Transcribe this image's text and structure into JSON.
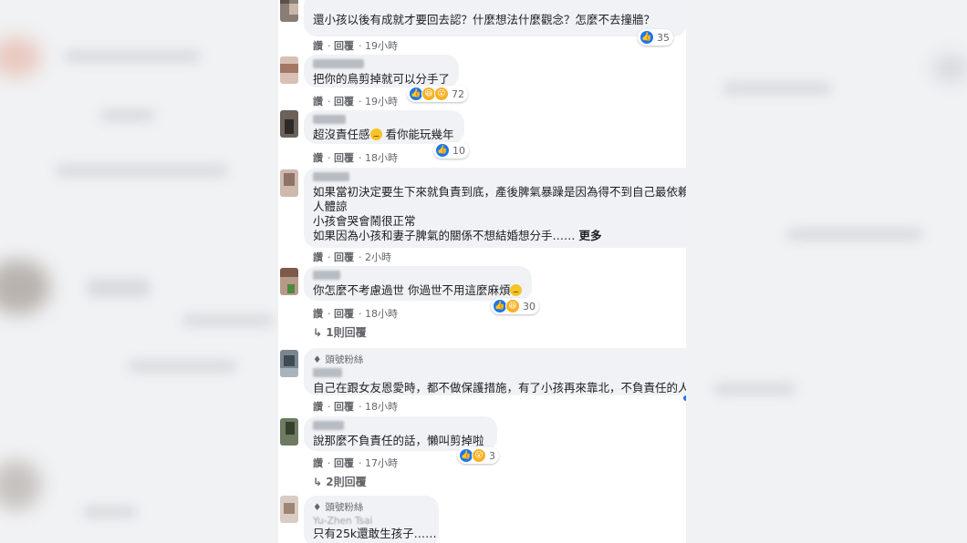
{
  "colors": {
    "accent": "#1877f2",
    "bubble": "#f0f2f5",
    "meta": "#65676b",
    "text": "#1c1e21"
  },
  "comments": [
    {
      "text": [
        "還小孩以後有成就才要回去認？什麼想法什麼觀念？怎麼不去撞牆？"
      ],
      "actions": {
        "like": "讚",
        "reply": "回覆",
        "time": "19小時"
      },
      "reactions": {
        "icons": [
          "like-icon"
        ],
        "count": "35"
      }
    },
    {
      "text": [
        "把你的鳥剪掉就可以分手了"
      ],
      "actions": {
        "like": "讚",
        "reply": "回覆",
        "time": "19小時"
      },
      "reactions": {
        "icons": [
          "like-icon",
          "haha-icon",
          "wow-icon"
        ],
        "count": "72"
      }
    },
    {
      "text": [
        "超沒責任感",
        "看你能玩幾年"
      ],
      "actions": {
        "like": "讚",
        "reply": "回覆",
        "time": "18小時"
      },
      "reactions": {
        "icons": [
          "like-icon"
        ],
        "count": "10"
      }
    },
    {
      "text": [
        "如果當初決定要生下來就負責到底，產後脾氣暴躁是因為得不到自己最依賴",
        "人體諒",
        "小孩會哭會鬧很正常",
        "如果因為小孩和妻子脾氣的關係不想結婚想分手……"
      ],
      "see_more": "更多",
      "actions": {
        "like": "讚",
        "reply": "回覆",
        "time": "2小時"
      }
    },
    {
      "text": [
        "你怎麼不考慮過世 你過世不用這麼麻煩"
      ],
      "actions": {
        "like": "讚",
        "reply": "回覆",
        "time": "18小時"
      },
      "reactions": {
        "icons": [
          "like-icon",
          "haha-icon"
        ],
        "count": "30"
      },
      "replies": "1則回覆"
    },
    {
      "badge": "頭號粉絲",
      "text": [
        "自己在跟女友恩愛時，都不做保護措施，有了小孩再來靠北，不負責任的人"
      ],
      "actions": {
        "like": "讚",
        "reply": "回覆",
        "time": "18小時"
      }
    },
    {
      "text": [
        "說那麼不負責任的話，懶叫剪掉啦"
      ],
      "actions": {
        "like": "讚",
        "reply": "回覆",
        "time": "17小時"
      },
      "reactions": {
        "icons": [
          "like-icon",
          "wow-icon"
        ],
        "count": "3"
      },
      "replies": "2則回覆"
    },
    {
      "badge": "頭號粉絲",
      "name_visible": "Yu-Zhen Tsai",
      "text": [
        "只有25k還敢生孩子……"
      ]
    }
  ]
}
